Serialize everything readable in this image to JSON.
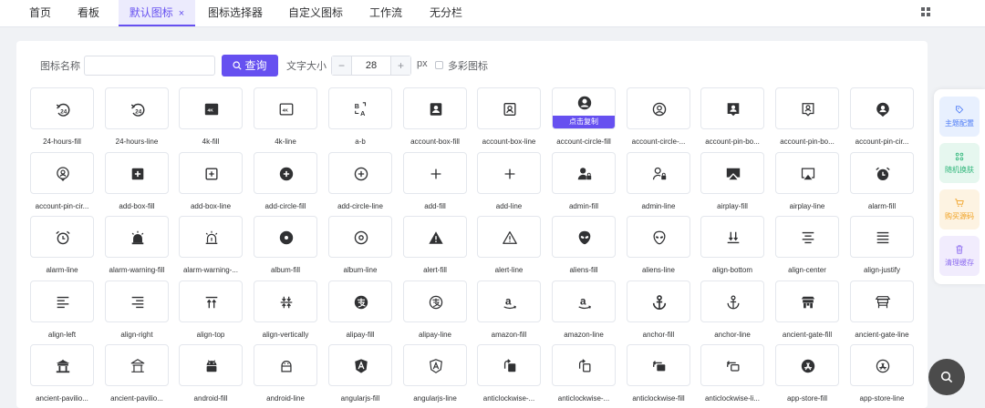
{
  "tabs": [
    {
      "label": "首页",
      "active": false
    },
    {
      "label": "看板",
      "active": false
    },
    {
      "label": "默认图标",
      "active": true,
      "close": "×"
    },
    {
      "label": "图标选择器",
      "active": false
    },
    {
      "label": "自定义图标",
      "active": false
    },
    {
      "label": "工作流",
      "active": false
    },
    {
      "label": "无分栏",
      "active": false
    }
  ],
  "toolbar": {
    "name_label": "图标名称",
    "name_value": "",
    "query_label": "查询",
    "size_label": "文字大小",
    "minus": "−",
    "size_value": "28",
    "plus": "+",
    "unit": "px",
    "multicolor_label": "多彩图标"
  },
  "copy_label": "点击复制",
  "icons": [
    {
      "name": "24-hours-fill",
      "glyph": "h24"
    },
    {
      "name": "24-hours-line",
      "glyph": "h24"
    },
    {
      "name": "4k-fill",
      "glyph": "k4fill"
    },
    {
      "name": "4k-line",
      "glyph": "k4line"
    },
    {
      "name": "a-b",
      "glyph": "ab"
    },
    {
      "name": "account-box-fill",
      "glyph": "boxfill"
    },
    {
      "name": "account-box-line",
      "glyph": "boxline"
    },
    {
      "name": "account-circle-fill",
      "glyph": "circlefill",
      "hover": true
    },
    {
      "name": "account-circle-...",
      "glyph": "circleline"
    },
    {
      "name": "account-pin-bo...",
      "glyph": "pinboxfill"
    },
    {
      "name": "account-pin-bo...",
      "glyph": "pinboxline"
    },
    {
      "name": "account-pin-cir...",
      "glyph": "pincirclefill"
    },
    {
      "name": "account-pin-cir...",
      "glyph": "pincircleline"
    },
    {
      "name": "add-box-fill",
      "glyph": "addboxfill"
    },
    {
      "name": "add-box-line",
      "glyph": "addboxline"
    },
    {
      "name": "add-circle-fill",
      "glyph": "addcirclefill"
    },
    {
      "name": "add-circle-line",
      "glyph": "addcircleline"
    },
    {
      "name": "add-fill",
      "glyph": "plus"
    },
    {
      "name": "add-line",
      "glyph": "plus"
    },
    {
      "name": "admin-fill",
      "glyph": "adminfill"
    },
    {
      "name": "admin-line",
      "glyph": "adminline"
    },
    {
      "name": "airplay-fill",
      "glyph": "airplayfill"
    },
    {
      "name": "airplay-line",
      "glyph": "airplayline"
    },
    {
      "name": "alarm-fill",
      "glyph": "alarmfill"
    },
    {
      "name": "alarm-line",
      "glyph": "alarmline"
    },
    {
      "name": "alarm-warning-fill",
      "glyph": "alarmwarnfill"
    },
    {
      "name": "alarm-warning-...",
      "glyph": "alarmwarnline"
    },
    {
      "name": "album-fill",
      "glyph": "albumfill"
    },
    {
      "name": "album-line",
      "glyph": "albumline"
    },
    {
      "name": "alert-fill",
      "glyph": "alertfill"
    },
    {
      "name": "alert-line",
      "glyph": "alertline"
    },
    {
      "name": "aliens-fill",
      "glyph": "alienfill"
    },
    {
      "name": "aliens-line",
      "glyph": "alienline"
    },
    {
      "name": "align-bottom",
      "glyph": "alignbottom"
    },
    {
      "name": "align-center",
      "glyph": "aligncenter"
    },
    {
      "name": "align-justify",
      "glyph": "alignjustify"
    },
    {
      "name": "align-left",
      "glyph": "alignleft"
    },
    {
      "name": "align-right",
      "glyph": "alignright"
    },
    {
      "name": "align-top",
      "glyph": "aligntop"
    },
    {
      "name": "align-vertically",
      "glyph": "alignvert"
    },
    {
      "name": "alipay-fill",
      "glyph": "alipayfill"
    },
    {
      "name": "alipay-line",
      "glyph": "alipayline"
    },
    {
      "name": "amazon-fill",
      "glyph": "amazon"
    },
    {
      "name": "amazon-line",
      "glyph": "amazon"
    },
    {
      "name": "anchor-fill",
      "glyph": "anchorfill"
    },
    {
      "name": "anchor-line",
      "glyph": "anchorline"
    },
    {
      "name": "ancient-gate-fill",
      "glyph": "gatefill"
    },
    {
      "name": "ancient-gate-line",
      "glyph": "gateline"
    },
    {
      "name": "ancient-pavilio...",
      "glyph": "pavfill"
    },
    {
      "name": "ancient-pavilio...",
      "glyph": "pavline"
    },
    {
      "name": "android-fill",
      "glyph": "androidfill"
    },
    {
      "name": "android-line",
      "glyph": "androidline"
    },
    {
      "name": "angularjs-fill",
      "glyph": "angularfill"
    },
    {
      "name": "angularjs-line",
      "glyph": "angularline"
    },
    {
      "name": "anticlockwise-...",
      "glyph": "acw2fill"
    },
    {
      "name": "anticlockwise-...",
      "glyph": "acw2line"
    },
    {
      "name": "anticlockwise-fill",
      "glyph": "acwfill"
    },
    {
      "name": "anticlockwise-li...",
      "glyph": "acwline"
    },
    {
      "name": "app-store-fill",
      "glyph": "appstorefill"
    },
    {
      "name": "app-store-line",
      "glyph": "appstoreline"
    }
  ],
  "side_panel": [
    {
      "label": "主题配置",
      "color": "#4e7cf6",
      "bg": "#e8f0fe",
      "icon": "palette-icon"
    },
    {
      "label": "随机换肤",
      "color": "#2fb67a",
      "bg": "#e6f7ef",
      "icon": "shuffle-icon"
    },
    {
      "label": "购买源码",
      "color": "#f0a020",
      "bg": "#fdf3e2",
      "icon": "cart-icon"
    },
    {
      "label": "清理缓存",
      "color": "#8c6bf0",
      "bg": "#f1ecfd",
      "icon": "trash-icon"
    }
  ],
  "colors": {
    "primary": "#6650f0",
    "icon": "#303133"
  }
}
